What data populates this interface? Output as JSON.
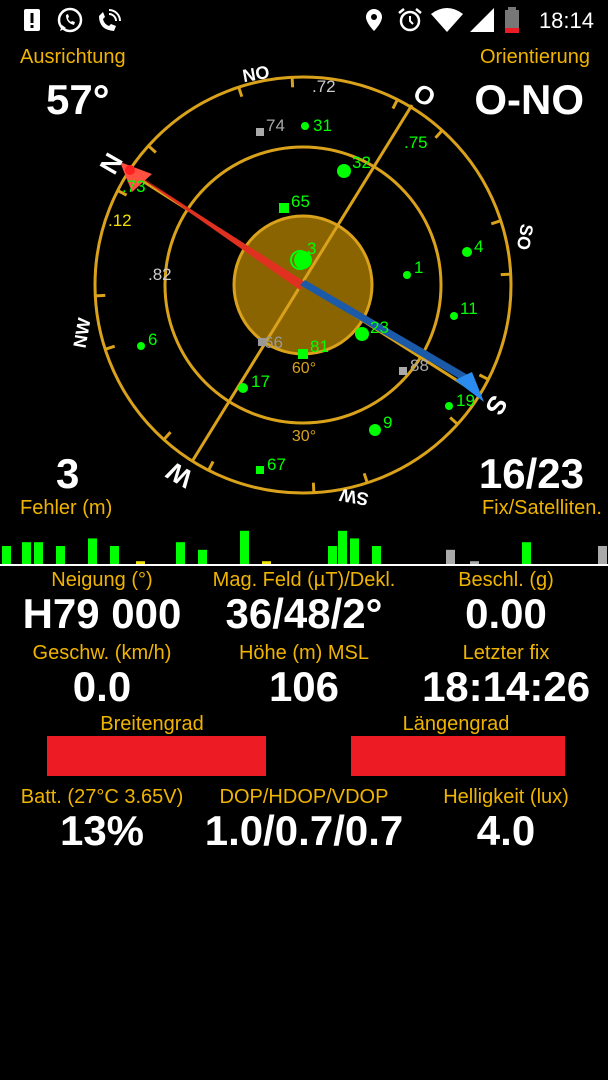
{
  "statusbar": {
    "time": "18:14",
    "icons_left": [
      "alert-icon",
      "whatsapp-icon",
      "wifi-calling-icon"
    ],
    "icons_right": [
      "location-icon",
      "alarm-icon",
      "wifi-icon",
      "signal-icon",
      "battery-icon"
    ]
  },
  "heading": {
    "label": "Ausrichtung",
    "value": "57°"
  },
  "orientation": {
    "label": "Orientierung",
    "value": "O-NO"
  },
  "error": {
    "value": "3",
    "label": "Fehler (m)"
  },
  "fix": {
    "value": "16/23",
    "label": "Fix/Satelliten."
  },
  "compass": {
    "directions": {
      "north": "N",
      "northeast": "NO",
      "east": "O",
      "southeast": "SO",
      "south": "S",
      "southwest": "SW",
      "west": "W",
      "northwest": "NW"
    },
    "elevation_labels": [
      "60°",
      "30°"
    ],
    "satellites": [
      {
        "id": "3",
        "color": "#00ff00",
        "shape": "circle"
      },
      {
        "id": "1",
        "color": "#00ff00",
        "shape": "circle"
      },
      {
        "id": "4",
        "color": "#00ff00",
        "shape": "circle"
      },
      {
        "id": "11",
        "color": "#00ff00",
        "shape": "circle"
      },
      {
        "id": "23",
        "color": "#00ff00",
        "shape": "circle"
      },
      {
        "id": "32",
        "color": "#00ff00",
        "shape": "circle"
      },
      {
        "id": "31",
        "color": "#00ff00",
        "shape": "circle"
      },
      {
        "id": "65",
        "color": "#00ff00",
        "shape": "square"
      },
      {
        "id": "81",
        "color": "#00ff00",
        "shape": "square"
      },
      {
        "id": "66",
        "color": "#999999",
        "shape": "square"
      },
      {
        "id": "17",
        "color": "#00ff00",
        "shape": "circle"
      },
      {
        "id": "6",
        "color": "#00ff00",
        "shape": "circle"
      },
      {
        "id": "9",
        "color": "#00ff00",
        "shape": "circle"
      },
      {
        "id": "19",
        "color": "#00ff00",
        "shape": "circle"
      },
      {
        "id": "67",
        "color": "#00ff00",
        "shape": "square"
      },
      {
        "id": "74",
        "color": "#aaaaaa",
        "shape": "square"
      },
      {
        "id": "88",
        "color": "#aaaaaa",
        "shape": "square"
      },
      {
        "id": ".72",
        "color": "#cccccc",
        "shape": "none"
      },
      {
        "id": ".75",
        "color": "#00ff00",
        "shape": "none"
      },
      {
        "id": ".73",
        "color": "#00ff00",
        "shape": "none"
      },
      {
        "id": ".12",
        "color": "#f0e000",
        "shape": "none"
      },
      {
        "id": ".82",
        "color": "#cccccc",
        "shape": "none"
      }
    ]
  },
  "stats": {
    "tilt_label": "Neigung (°)",
    "tilt_value": "H79 000",
    "mag_label": "Mag. Feld (µT)/Dekl.",
    "mag_value": "36/48/2°",
    "accel_label": "Beschl. (g)",
    "accel_value": "0.00",
    "speed_label": "Geschw. (km/h)",
    "speed_value": "0.0",
    "altitude_label": "Höhe (m) MSL",
    "altitude_value": "106",
    "lastfix_label": "Letzter fix",
    "lastfix_value": "18:14:26",
    "latitude_label": "Breitengrad",
    "longitude_label": "Längengrad",
    "battery_label": "Batt. (27°C 3.65V)",
    "battery_value": "13%",
    "dop_label": "DOP/HDOP/VDOP",
    "dop_value": "1.0/0.7/0.7",
    "brightness_label": "Helligkeit (lux)",
    "brightness_value": "4.0"
  },
  "signal_bars": [
    {
      "level": 0.5,
      "color": "#00ff00"
    },
    {
      "level": 0.6,
      "color": "#00ff00"
    },
    {
      "level": 0.6,
      "color": "#00ff00"
    },
    {
      "level": 0.5,
      "color": "#00ff00"
    },
    {
      "level": 0.7,
      "color": "#00ff00"
    },
    {
      "level": 0.5,
      "color": "#00ff00"
    },
    {
      "level": 0.1,
      "color": "#f0e000"
    },
    {
      "level": 0.6,
      "color": "#00ff00"
    },
    {
      "level": 0.4,
      "color": "#00ff00"
    },
    {
      "level": 0.9,
      "color": "#00ff00"
    },
    {
      "level": 0.1,
      "color": "#f0e000"
    },
    {
      "level": 0.5,
      "color": "#00ff00"
    },
    {
      "level": 0.9,
      "color": "#00ff00"
    },
    {
      "level": 0.7,
      "color": "#00ff00"
    },
    {
      "level": 0.5,
      "color": "#00ff00"
    },
    {
      "level": 0.4,
      "color": "#aaaaaa"
    },
    {
      "level": 0.1,
      "color": "#aaaaaa"
    },
    {
      "level": 0.6,
      "color": "#00ff00"
    },
    {
      "level": 0.5,
      "color": "#aaaaaa"
    }
  ]
}
